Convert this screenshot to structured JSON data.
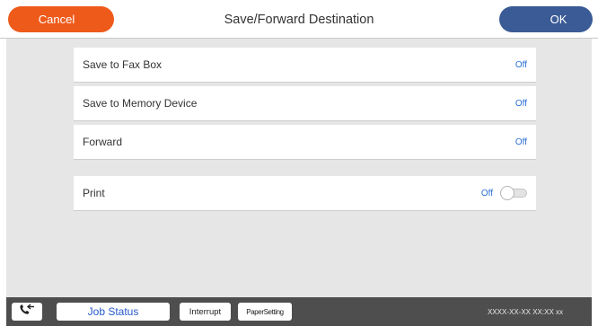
{
  "header": {
    "cancel_label": "Cancel",
    "title": "Save/Forward Destination",
    "ok_label": "OK"
  },
  "settings": [
    {
      "label": "Save to Fax Box",
      "value": "Off"
    },
    {
      "label": "Save to Memory Device",
      "value": "Off"
    },
    {
      "label": "Forward",
      "value": "Off"
    },
    {
      "label": "Print",
      "value": "Off",
      "toggle_on": false
    }
  ],
  "footer": {
    "fax_icon": "fax-icon",
    "job_status_label": "Job Status",
    "interrupt_label": "Interrupt",
    "paper_setting_label": "PaperSetting",
    "datetime": "XXXX-XX-XX XX:XX xx"
  },
  "colors": {
    "cancel": "#ee5a1a",
    "ok": "#3a5b95",
    "value_text": "#2a6fd6",
    "job_status_text": "#2557c9",
    "footer_bg": "#4e4e4e",
    "content_bg": "#e6e6e6"
  }
}
